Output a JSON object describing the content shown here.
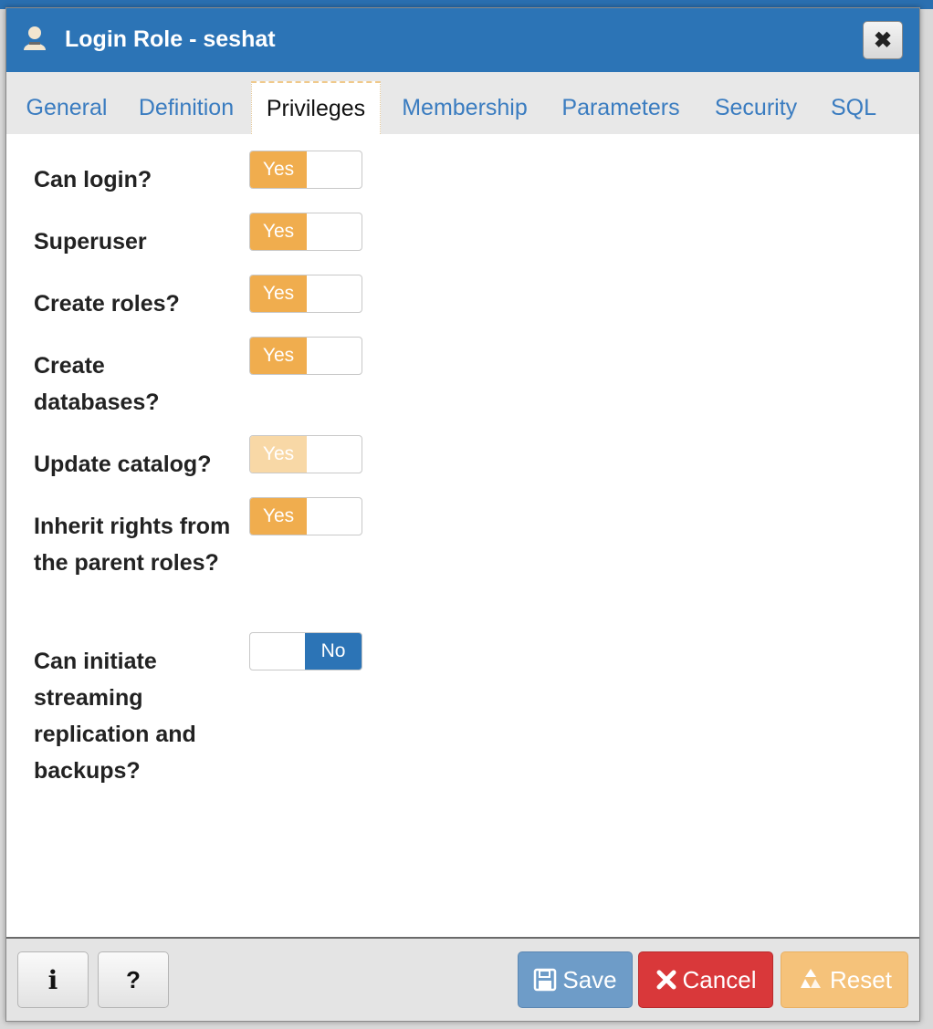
{
  "dialog": {
    "title": "Login Role - seshat",
    "title_icon": "user-icon",
    "close_label": "✖"
  },
  "tabs": [
    {
      "label": "General",
      "active": false
    },
    {
      "label": "Definition",
      "active": false
    },
    {
      "label": "Privileges",
      "active": true
    },
    {
      "label": "Membership",
      "active": false
    },
    {
      "label": "Parameters",
      "active": false
    },
    {
      "label": "Security",
      "active": false
    },
    {
      "label": "SQL",
      "active": false
    }
  ],
  "fields": [
    {
      "label": "Can login?",
      "value": "Yes",
      "enabled": true
    },
    {
      "label": "Superuser",
      "value": "Yes",
      "enabled": true
    },
    {
      "label": "Create roles?",
      "value": "Yes",
      "enabled": true
    },
    {
      "label": "Create databases?",
      "value": "Yes",
      "enabled": true
    },
    {
      "label": "Update catalog?",
      "value": "Yes",
      "enabled": false
    },
    {
      "label": "Inherit rights from the parent roles?",
      "value": "Yes",
      "enabled": true
    },
    {
      "label": "Can initiate streaming replication and backups?",
      "value": "No",
      "enabled": true
    }
  ],
  "footer": {
    "info_label": "i",
    "help_label": "?",
    "save_label": "Save",
    "cancel_label": "Cancel",
    "reset_label": "Reset"
  },
  "colors": {
    "titlebar": "#2c74b6",
    "tab_link": "#3a7cc0",
    "toggle_yes": "#f0ad4e",
    "toggle_no": "#2c74b6",
    "save": "#6e9cc8",
    "cancel": "#d9383a",
    "reset": "#f5c27a"
  }
}
